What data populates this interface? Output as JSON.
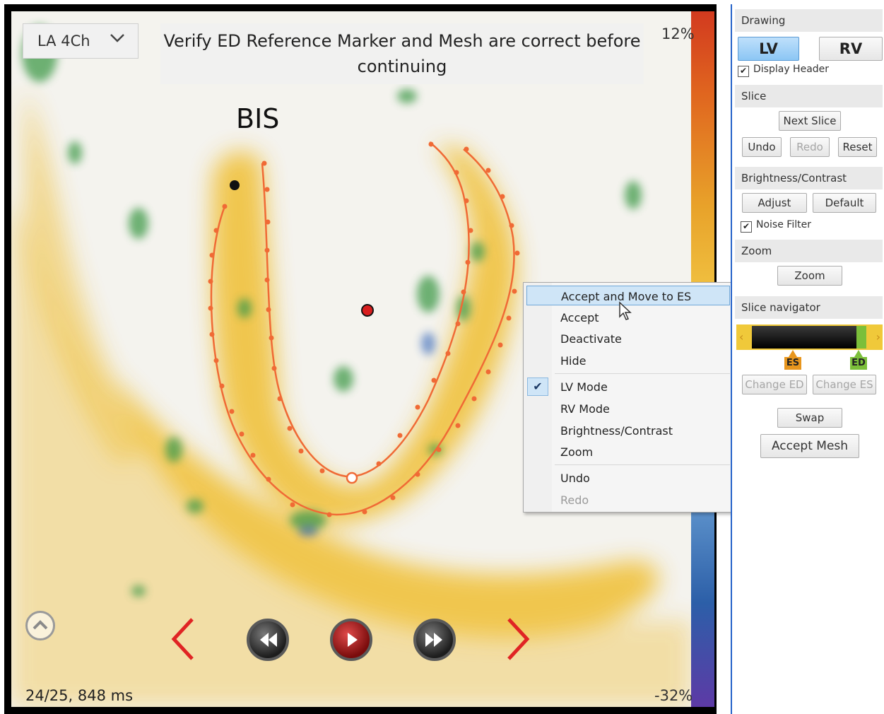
{
  "viewer": {
    "view_select": "LA 4Ch",
    "banner": "Verify ED Reference Marker and Mesh are correct before continuing",
    "region_label": "BIS",
    "scale_top": "12%",
    "scale_bottom": "-32%",
    "frame_info": "24/25, 848 ms"
  },
  "context_menu": {
    "items": [
      {
        "label": "Accept and Move to ES",
        "highlighted": true
      },
      {
        "label": "Accept"
      },
      {
        "label": "Deactivate"
      },
      {
        "label": "Hide"
      },
      {
        "label": "LV Mode",
        "checked": true
      },
      {
        "label": "RV Mode"
      },
      {
        "label": "Brightness/Contrast"
      },
      {
        "label": "Zoom"
      },
      {
        "label": "Undo"
      },
      {
        "label": "Redo",
        "disabled": true
      }
    ]
  },
  "panel": {
    "drawing": {
      "header": "Drawing",
      "lv": "LV",
      "rv": "RV",
      "display_header": "Display Header"
    },
    "slice": {
      "header": "Slice",
      "next_slice": "Next Slice",
      "undo": "Undo",
      "redo": "Redo",
      "reset": "Reset"
    },
    "brightness": {
      "header": "Brightness/Contrast",
      "adjust": "Adjust",
      "default": "Default",
      "noise_filter": "Noise Filter"
    },
    "zoom": {
      "header": "Zoom",
      "zoom": "Zoom"
    },
    "slice_navigator": {
      "header": "Slice navigator",
      "es": "ES",
      "ed": "ED",
      "change_ed": "Change ED",
      "change_es": "Change ES",
      "swap": "Swap",
      "accept_mesh": "Accept Mesh"
    }
  },
  "colors": {
    "accent": "#2563c9",
    "mesh": "#f06a35",
    "myocardium": "#f1c548",
    "es_marker": "#e8961e",
    "ed_marker": "#7bbf3a"
  }
}
